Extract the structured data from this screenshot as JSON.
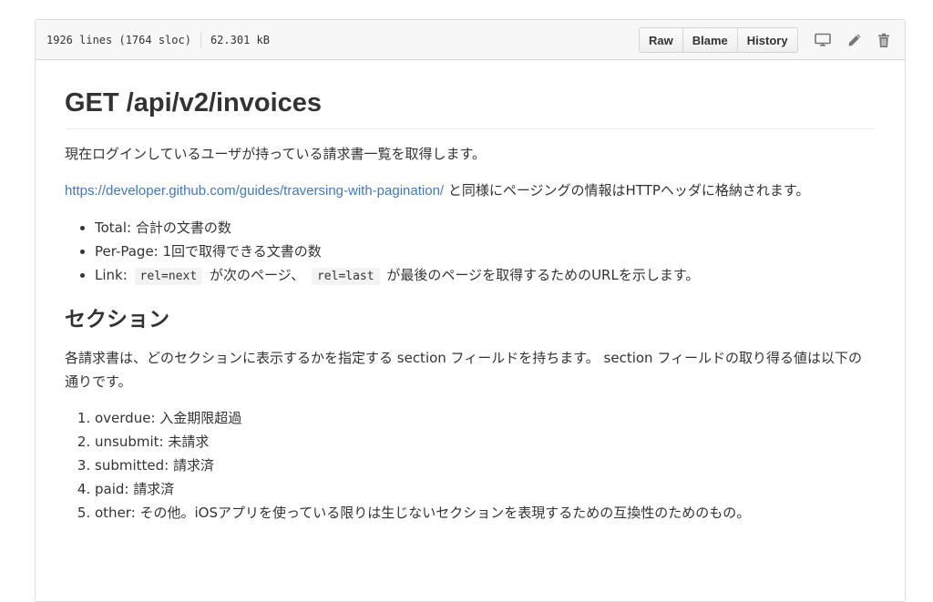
{
  "file_header": {
    "lines": "1926 lines (1764 sloc)",
    "size": "62.301 kB",
    "buttons": {
      "raw": "Raw",
      "blame": "Blame",
      "history": "History"
    },
    "icons": [
      "desktop-icon",
      "pencil-icon",
      "trash-icon"
    ]
  },
  "doc": {
    "title": "GET /api/v2/invoices",
    "intro": "現在ログインしているユーザが持っている請求書一覧を取得します。",
    "pagination_link": "https://developer.github.com/guides/traversing-with-pagination/",
    "pagination_text": " と同様にページングの情報はHTTPヘッダに格納されます。",
    "headers_list": {
      "total": "Total: 合計の文書の数",
      "per_page": "Per-Page: 1回で取得できる文書の数",
      "link_prefix": "Link: ",
      "code_next": "rel=next",
      "link_mid": " が次のページ、 ",
      "code_last": "rel=last",
      "link_suffix": " が最後のページを取得するためのURLを示します。"
    },
    "section_heading": "セクション",
    "section_desc": "各請求書は、どのセクションに表示するかを指定する section フィールドを持ちます。 section フィールドの取り得る値は以下の通りです。",
    "section_values": [
      "overdue: 入金期限超過",
      "unsubmit: 未請求",
      "submitted: 請求済",
      "paid: 請求済",
      "other: その他。iOSアプリを使っている限りは生じないセクションを表現するための互換性のためのもの。"
    ]
  }
}
